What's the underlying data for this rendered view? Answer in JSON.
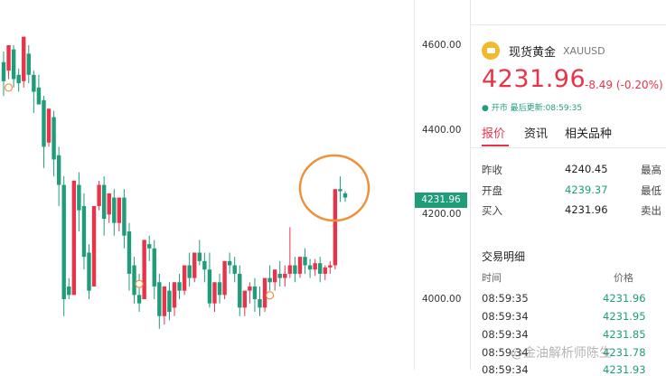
{
  "chart_data": {
    "type": "candlestick",
    "instrument": "XAUUSD",
    "y_ticks": [
      "4600.00",
      "4400.00",
      "4200.00",
      "4000.00"
    ],
    "ylim": [
      3976,
      4700
    ],
    "last_price_tag": "4231.96",
    "colors": {
      "up": "#e8344a",
      "down": "#1f9d7a",
      "highlight": "#f0913a"
    },
    "candles": [
      [
        4560,
        4585,
        4515,
        4480
      ],
      [
        4540,
        4560,
        4600,
        4520
      ],
      [
        4590,
        4600,
        4520,
        4500
      ],
      [
        4530,
        4545,
        4510,
        4490
      ],
      [
        4515,
        4590,
        4620,
        4500
      ],
      [
        4580,
        4600,
        4530,
        4510
      ],
      [
        4530,
        4540,
        4490,
        4440
      ],
      [
        4500,
        4530,
        4460,
        4460
      ],
      [
        4470,
        4480,
        4360,
        4310
      ],
      [
        4370,
        4440,
        4450,
        4360
      ],
      [
        4430,
        4445,
        4330,
        4290
      ],
      [
        4340,
        4360,
        4270,
        4220
      ],
      [
        4270,
        4290,
        4000,
        3960
      ],
      [
        4030,
        4050,
        4010,
        4000
      ],
      [
        4010,
        4030,
        4280,
        4200
      ],
      [
        4270,
        4300,
        4210,
        4160
      ],
      [
        4220,
        4250,
        4100,
        4070
      ],
      [
        4110,
        4130,
        4020,
        4000
      ],
      [
        4030,
        4050,
        4220,
        4180
      ],
      [
        4220,
        4280,
        4270,
        4210
      ],
      [
        4270,
        4290,
        4190,
        4150
      ],
      [
        4200,
        4225,
        4250,
        4180
      ],
      [
        4240,
        4260,
        4180,
        4150
      ],
      [
        4180,
        4230,
        4240,
        4160
      ],
      [
        4240,
        4260,
        4150,
        4120
      ],
      [
        4160,
        4180,
        4060,
        4020
      ],
      [
        4080,
        4100,
        4010,
        3990
      ],
      [
        4010,
        4060,
        3990,
        3970
      ],
      [
        4000,
        4050,
        4140,
        4040
      ],
      [
        4130,
        4150,
        4120,
        4090
      ],
      [
        4120,
        4140,
        4030,
        4000
      ],
      [
        4040,
        4060,
        3960,
        3930
      ],
      [
        3960,
        3980,
        4030,
        3940
      ],
      [
        4020,
        4040,
        3970,
        3950
      ],
      [
        3980,
        4010,
        4040,
        3960
      ],
      [
        4040,
        4060,
        4020,
        4000
      ],
      [
        4020,
        4060,
        4080,
        4010
      ],
      [
        4080,
        4110,
        4050,
        4030
      ],
      [
        4050,
        4090,
        4110,
        4040
      ],
      [
        4110,
        4140,
        4090,
        4080
      ],
      [
        4090,
        4110,
        4070,
        4040
      ],
      [
        4070,
        4110,
        3990,
        3980
      ],
      [
        3990,
        4010,
        4040,
        3970
      ],
      [
        4040,
        4060,
        4010,
        3990
      ],
      [
        4010,
        4040,
        4090,
        4000
      ],
      [
        4090,
        4110,
        4080,
        4060
      ],
      [
        4080,
        4100,
        4060,
        4040
      ],
      [
        4060,
        4080,
        3980,
        3960
      ],
      [
        3980,
        4000,
        4020,
        3960
      ],
      [
        4020,
        4040,
        4030,
        3990
      ],
      [
        4030,
        4050,
        4000,
        3970
      ],
      [
        4000,
        4030,
        3980,
        3960
      ],
      [
        3980,
        4000,
        4050,
        3970
      ],
      [
        4050,
        4080,
        4040,
        4020
      ],
      [
        4040,
        4060,
        4070,
        4020
      ],
      [
        4060,
        4090,
        4050,
        4030
      ],
      [
        4050,
        4080,
        4060,
        4030
      ],
      [
        4060,
        4170,
        4080,
        4050
      ],
      [
        4080,
        4100,
        4060,
        4040
      ],
      [
        4060,
        4080,
        4100,
        4050
      ],
      [
        4100,
        4120,
        4080,
        4060
      ],
      [
        4080,
        4095,
        4070,
        4050
      ],
      [
        4070,
        4095,
        4085,
        4055
      ],
      [
        4085,
        4100,
        4060,
        4040
      ],
      [
        4060,
        4080,
        4075,
        4045
      ],
      [
        4075,
        4090,
        4080,
        4060
      ],
      [
        4080,
        4250,
        4260,
        4070
      ],
      [
        4260,
        4290,
        4255,
        4230
      ],
      [
        4250,
        4255,
        4240,
        4230
      ]
    ]
  },
  "price_axis": {
    "current_tag": "4231.96"
  },
  "instrument": {
    "name": "现货黄金",
    "code": "XAUUSD",
    "price": "4231.96",
    "change": "-8.49 (-0.20%)",
    "status": "开市",
    "last_update": "最后更新:08:59:35"
  },
  "tabs": [
    "报价",
    "资讯",
    "相关品种"
  ],
  "quote": [
    {
      "label": "昨收",
      "value": "4240.45",
      "label2": "最高",
      "color": "#222222"
    },
    {
      "label": "开盘",
      "value": "4239.37",
      "label2": "最低",
      "color": "#1f9d7a"
    },
    {
      "label": "买入",
      "value": "4231.96",
      "label2": "卖出",
      "color": "#222222"
    }
  ],
  "trades": {
    "title": "交易明细",
    "col_time": "时间",
    "col_price": "价格",
    "rows": [
      {
        "time": "08:59:35",
        "price": "4231.96"
      },
      {
        "time": "08:59:34",
        "price": "4231.95"
      },
      {
        "time": "08:59:34",
        "price": "4231.85"
      },
      {
        "time": "08:59:34",
        "price": "4231.78"
      },
      {
        "time": "08:59:34",
        "price": "4231.93"
      }
    ]
  },
  "watermark": "@金油解析师陈生"
}
